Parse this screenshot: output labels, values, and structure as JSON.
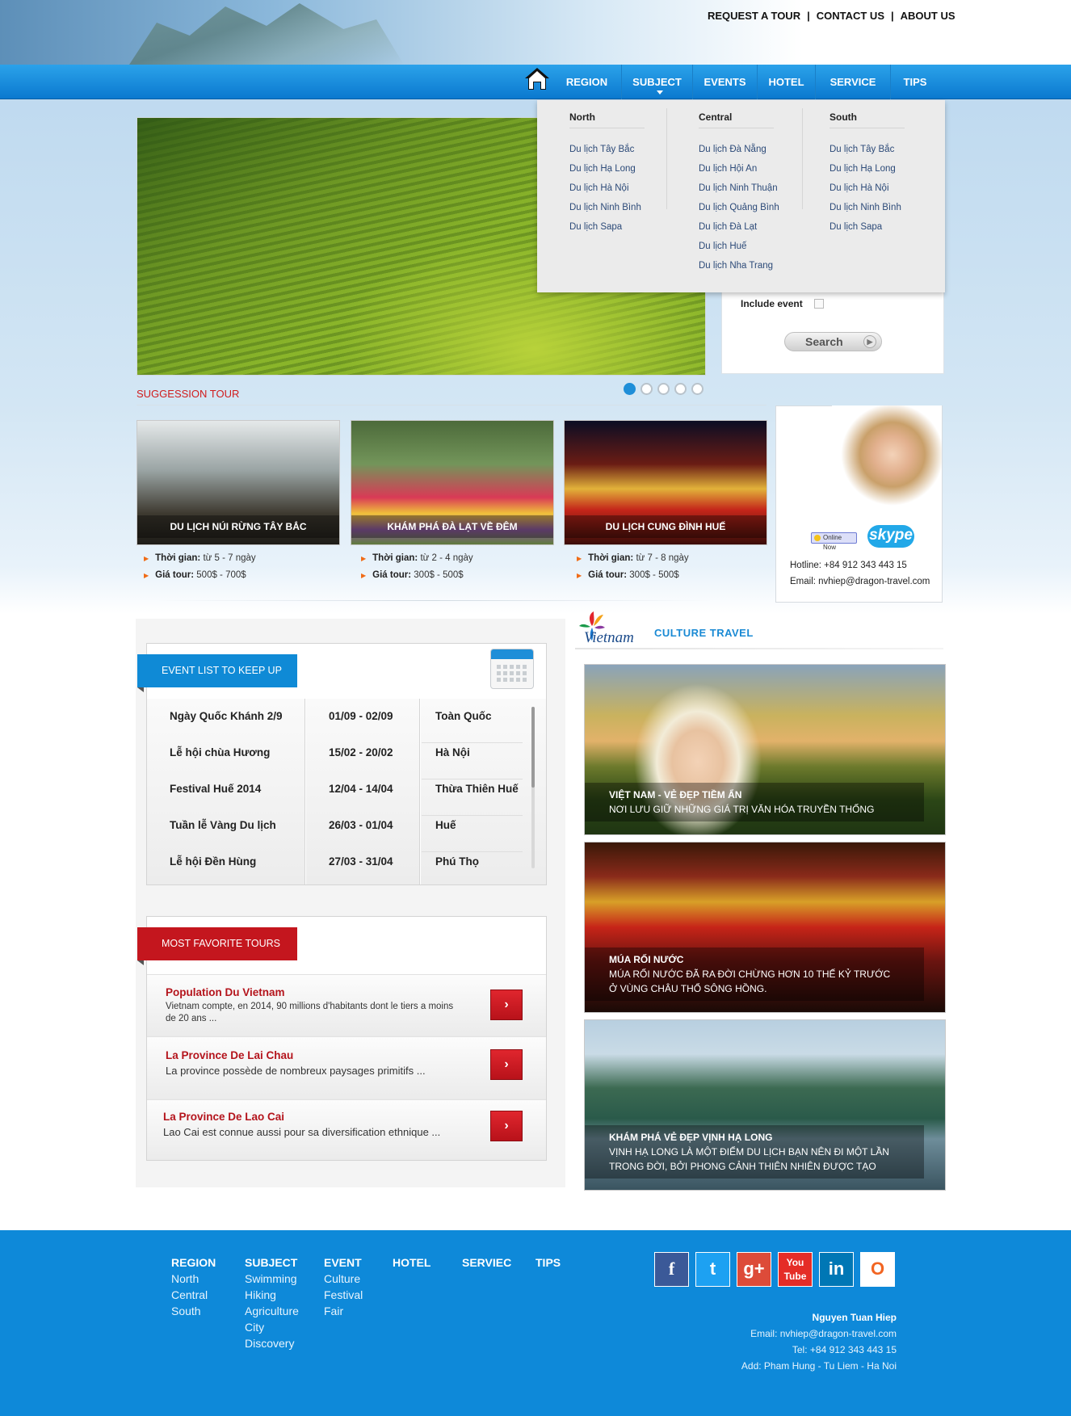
{
  "top_links": [
    "REQUEST A TOUR",
    "CONTACT US",
    "ABOUT US"
  ],
  "nav": {
    "home_icon": "home-icon",
    "items": [
      "REGION",
      "SUBJECT",
      "EVENTS",
      "HOTEL",
      "SERVICE",
      "TIPS"
    ]
  },
  "dropdown": {
    "columns": [
      {
        "heading": "North",
        "items": [
          "Du lịch Tây Bắc",
          "Du lịch Hạ Long",
          "Du lịch Hà Nội",
          "Du lịch Ninh Bình",
          "Du lịch Sapa"
        ]
      },
      {
        "heading": "Central",
        "items": [
          "Du lịch Đà Nẵng",
          "Du lịch Hội An",
          "Du lịch Ninh Thuận",
          "Du lịch Quảng Bình",
          "Du lịch Đà Lạt",
          "Du lịch Huế",
          "Du lịch Nha Trang"
        ]
      },
      {
        "heading": "South",
        "items": [
          "Du lịch Tây Bắc",
          "Du lịch Hạ Long",
          "Du lịch Hà Nội",
          "Du lịch Ninh Bình",
          "Du lịch Sapa"
        ]
      }
    ]
  },
  "search": {
    "include_event_label": "Include event",
    "button_label": "Search"
  },
  "slider": {
    "dot_count": 5,
    "active_index": 0
  },
  "suggestion": {
    "title": "SUGGESSION TOUR",
    "tours": [
      {
        "caption": "DU LỊCH NÚI RỪNG TÂY BẮC",
        "time_label": "Thời gian:",
        "time": " từ 5 - 7 ngày",
        "price_label": "Giá tour:",
        "price": " 500$ - 700$"
      },
      {
        "caption": "KHÁM PHÁ ĐÀ LẠT VỀ ĐÊM",
        "time_label": "Thời gian:",
        "time": " từ 2 - 4 ngày",
        "price_label": "Giá tour:",
        "price": " 300$ - 500$"
      },
      {
        "caption": "DU LỊCH CUNG ĐÌNH HUẾ",
        "time_label": "Thời gian:",
        "time": " từ 7 - 8 ngày",
        "price_label": "Giá tour:",
        "price": " 300$ - 500$"
      }
    ]
  },
  "support": {
    "online_label": "Online Now",
    "skype_label": "skype",
    "hotline": "Hotline: +84 912 343 443 15",
    "email": "Email: nvhiep@dragon-travel.com"
  },
  "events": {
    "title": "EVENT LIST TO KEEP UP",
    "rows": [
      [
        "Ngày Quốc Khánh 2/9",
        "01/09 - 02/09",
        "Toàn Quốc"
      ],
      [
        "Lễ hội chùa Hương",
        "15/02 - 20/02",
        "Hà Nội"
      ],
      [
        "Festival Huế 2014",
        "12/04 - 14/04",
        "Thừa Thiên Huế"
      ],
      [
        "Tuần lễ Vàng Du lịch",
        "26/03 - 01/04",
        "Huế"
      ],
      [
        "Lễ hội Đền Hùng",
        "27/03 - 31/04",
        "Phú Thọ"
      ]
    ]
  },
  "favorites": {
    "title": "MOST FAVORITE TOURS",
    "items": [
      {
        "title": "Population Du Vietnam",
        "desc": "Vietnam compte, en 2014, 90 millions d'habitants dont le tiers a moins de 20 ans ..."
      },
      {
        "title": "La Province De Lai Chau",
        "desc": "La province possède de nombreux paysages primitifs ..."
      },
      {
        "title": "La Province De Lao Cai",
        "desc": "Lao Cai est connue aussi pour sa diversification ethnique ..."
      }
    ]
  },
  "culture": {
    "logo_text": "Vietnam",
    "title": "CULTURE TRAVEL",
    "cards": [
      {
        "title": "VIỆT NAM - VẺ ĐẸP TIỀM ẨN",
        "desc": "NƠI LƯU GIỮ NHỮNG GIÁ TRỊ VĂN HÓA TRUYỀN THỐNG"
      },
      {
        "title": "MÚA RỐI NƯỚC",
        "desc": "MÚA RỐI NƯỚC ĐÃ RA ĐỜI CHỪNG HƠN 10 THẾ KỶ TRƯỚC Ở VÙNG CHÂU THỔ SÔNG HỒNG."
      },
      {
        "title": "KHÁM PHÁ VẺ ĐẸP VỊNH HẠ LONG",
        "desc": "VỊNH HẠ LONG LÀ MỘT ĐIỂM DU LỊCH BẠN NÊN ĐI MỘT LẦN TRONG ĐỜI, BỞI PHONG CẢNH THIÊN NHIÊN ĐƯỢC TẠO"
      }
    ]
  },
  "footer": {
    "columns": [
      {
        "heading": "REGION",
        "items": [
          "North",
          "Central",
          "South"
        ]
      },
      {
        "heading": "SUBJECT",
        "items": [
          "Swimming",
          "Hiking",
          "Agriculture",
          "City",
          "Discovery"
        ]
      },
      {
        "heading": "EVENT",
        "items": [
          "Culture",
          "Festival",
          "Fair"
        ]
      },
      {
        "heading": "HOTEL",
        "items": []
      },
      {
        "heading": "SERVIEC",
        "items": []
      },
      {
        "heading": "TIPS",
        "items": []
      }
    ],
    "social": [
      {
        "icon": "facebook-icon",
        "glyph": "f",
        "color": "#3b5998"
      },
      {
        "icon": "twitter-icon",
        "glyph": "t",
        "color": "#1da1f2"
      },
      {
        "icon": "google-plus-icon",
        "glyph": "g+",
        "color": "#dd4b39"
      },
      {
        "icon": "youtube-icon",
        "glyph": "You Tube",
        "color": "#e52d27"
      },
      {
        "icon": "linkedin-icon",
        "glyph": "in",
        "color": "#0077b5"
      },
      {
        "icon": "rss-icon",
        "glyph": "O",
        "color": "#ffffff"
      }
    ],
    "contact": {
      "name": "Nguyen Tuan Hiep",
      "email": "Email: nvhiep@dragon-travel.com",
      "tel": "Tel: +84 912 343 443 15",
      "address": "Add: Pham Hung - Tu Liem - Ha Noi"
    }
  },
  "colors": {
    "primary_blue": "#0e89d9",
    "accent_red": "#c4161e",
    "link_blue": "#2c4a78"
  }
}
